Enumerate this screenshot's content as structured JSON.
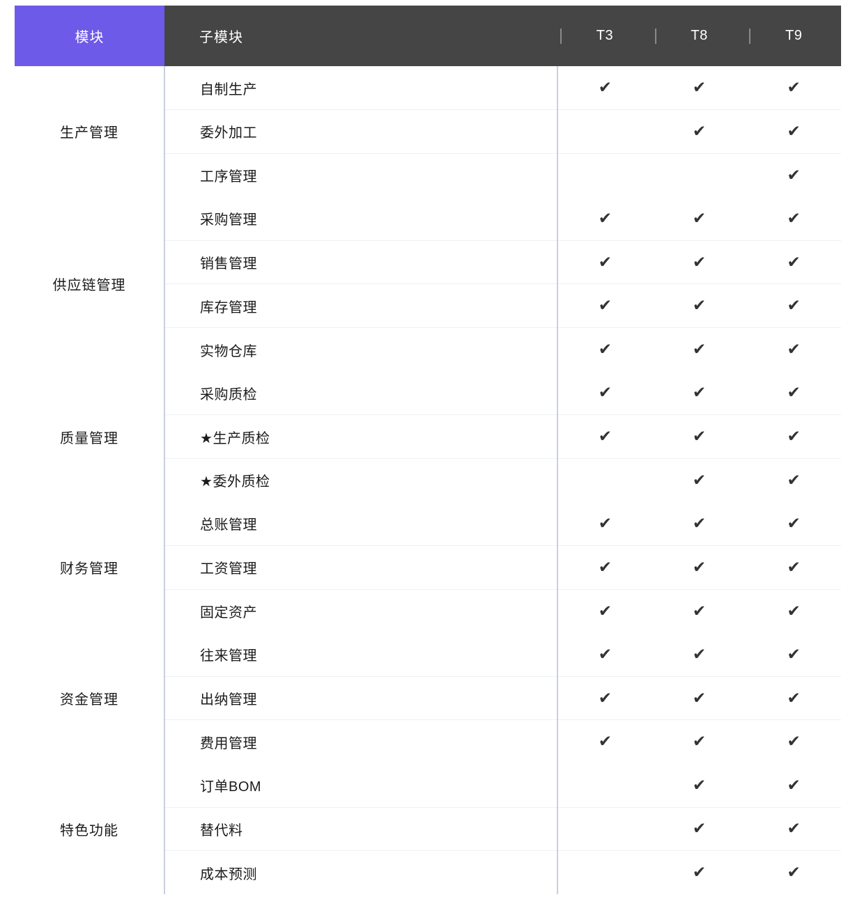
{
  "table": {
    "headers": {
      "module": "模块",
      "submodule": "子模块",
      "versions": [
        "T3",
        "T8",
        "T9"
      ]
    },
    "check_glyph": "✔",
    "colors": {
      "module_header_bg": "#6E5AE8",
      "submodule_header_bg": "#454545",
      "header_text": "#FFFFFF",
      "group_divider": "#C9CFDD",
      "row_divider": "#EEF0F5",
      "body_text": "#1B1B1B",
      "check_color": "#333333"
    },
    "groups": [
      {
        "module": "生产管理",
        "rows": [
          {
            "submodule": "自制生产",
            "support": [
              true,
              true,
              true
            ]
          },
          {
            "submodule": "委外加工",
            "support": [
              false,
              true,
              true
            ]
          },
          {
            "submodule": "工序管理",
            "support": [
              false,
              false,
              true
            ]
          }
        ]
      },
      {
        "module": "供应链管理",
        "rows": [
          {
            "submodule": "采购管理",
            "support": [
              true,
              true,
              true
            ]
          },
          {
            "submodule": "销售管理",
            "support": [
              true,
              true,
              true
            ]
          },
          {
            "submodule": "库存管理",
            "support": [
              true,
              true,
              true
            ]
          },
          {
            "submodule": "实物仓库",
            "support": [
              true,
              true,
              true
            ]
          }
        ]
      },
      {
        "module": "质量管理",
        "rows": [
          {
            "submodule": "采购质检",
            "support": [
              true,
              true,
              true
            ]
          },
          {
            "submodule": "★生产质检",
            "support": [
              true,
              true,
              true
            ]
          },
          {
            "submodule": "★委外质检",
            "support": [
              false,
              true,
              true
            ]
          }
        ]
      },
      {
        "module": "财务管理",
        "rows": [
          {
            "submodule": "总账管理",
            "support": [
              true,
              true,
              true
            ]
          },
          {
            "submodule": "工资管理",
            "support": [
              true,
              true,
              true
            ]
          },
          {
            "submodule": "固定资产",
            "support": [
              true,
              true,
              true
            ]
          }
        ]
      },
      {
        "module": "资金管理",
        "rows": [
          {
            "submodule": "往来管理",
            "support": [
              true,
              true,
              true
            ]
          },
          {
            "submodule": "出纳管理",
            "support": [
              true,
              true,
              true
            ]
          },
          {
            "submodule": "费用管理",
            "support": [
              true,
              true,
              true
            ]
          }
        ]
      },
      {
        "module": "特色功能",
        "rows": [
          {
            "submodule": "订单BOM",
            "support": [
              false,
              true,
              true
            ]
          },
          {
            "submodule": "替代料",
            "support": [
              false,
              true,
              true
            ]
          },
          {
            "submodule": "成本预测",
            "support": [
              false,
              true,
              true
            ]
          }
        ]
      }
    ]
  }
}
